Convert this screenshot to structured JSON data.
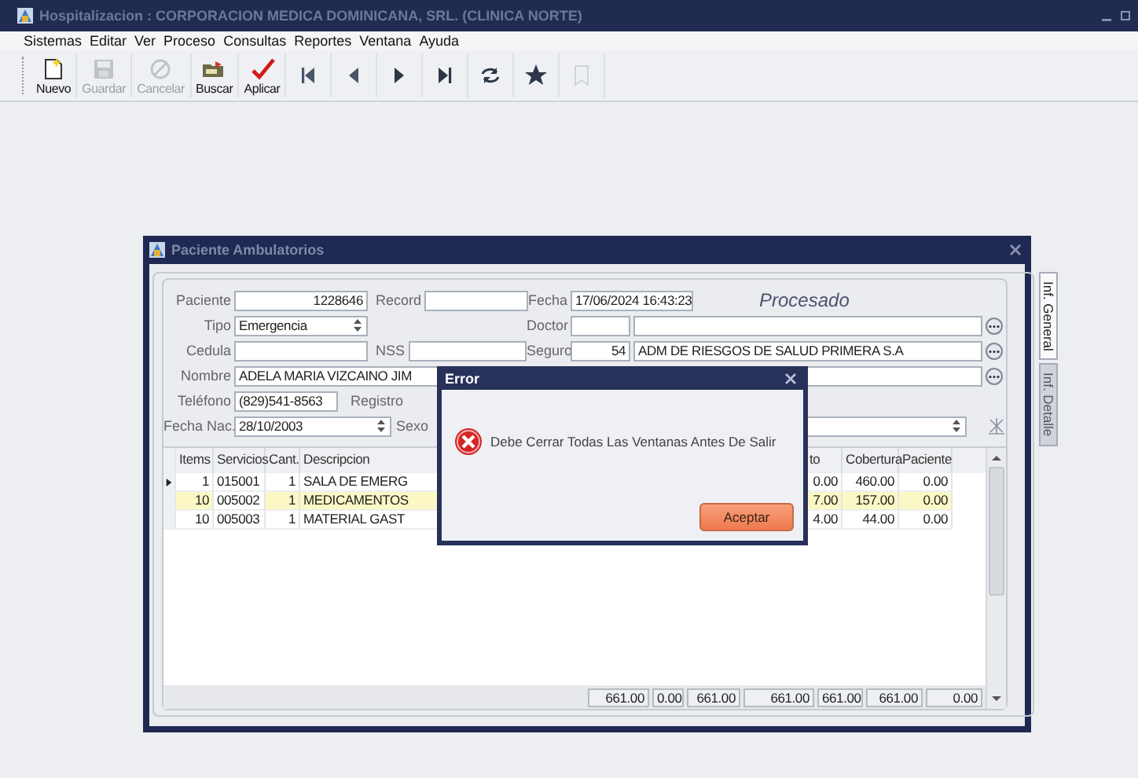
{
  "window": {
    "title": "Hospitalizacion : CORPORACION MEDICA DOMINICANA, SRL. (CLINICA NORTE)"
  },
  "menu": [
    "Sistemas",
    "Editar",
    "Ver",
    "Proceso",
    "Consultas",
    "Reportes",
    "Ventana",
    "Ayuda"
  ],
  "toolbar": [
    {
      "kind": "new",
      "label": "Nuevo",
      "disabled": false
    },
    {
      "kind": "save",
      "label": "Guardar",
      "disabled": true
    },
    {
      "kind": "cancel",
      "label": "Cancelar",
      "disabled": true
    },
    {
      "kind": "search",
      "label": "Buscar",
      "disabled": false
    },
    {
      "kind": "apply",
      "label": "Aplicar",
      "disabled": false
    },
    {
      "kind": "first",
      "disabled": false
    },
    {
      "kind": "prev",
      "disabled": false
    },
    {
      "kind": "next",
      "disabled": false
    },
    {
      "kind": "last",
      "disabled": false
    },
    {
      "kind": "refresh",
      "disabled": false
    },
    {
      "kind": "star",
      "disabled": false
    },
    {
      "kind": "bookmark",
      "disabled": true
    }
  ],
  "child_window": {
    "title": "Paciente Ambulatorios",
    "tabs": [
      {
        "label": "Inf. General",
        "selected": true
      },
      {
        "label": "Inf. Detalle",
        "selected": false
      }
    ],
    "form": {
      "paciente": {
        "label": "Paciente",
        "value": "1228646"
      },
      "record": {
        "label": "Record"
      },
      "fecha": {
        "label": "Fecha",
        "value": "17/06/2024 16:43:23"
      },
      "status": "Procesado",
      "tipo": {
        "label": "Tipo",
        "value": "Emergencia"
      },
      "doctor": {
        "label": "Doctor"
      },
      "cedula": {
        "label": "Cedula"
      },
      "nss": {
        "label": "NSS"
      },
      "seguro": {
        "label": "Seguro",
        "code": "54",
        "value": "ADM DE RIESGOS DE SALUD PRIMERA S.A"
      },
      "nombre": {
        "label": "Nombre",
        "value": "ADELA MARIA VIZCAINO JIM"
      },
      "telefono": {
        "label": "Teléfono",
        "value": "(829)541-8563"
      },
      "registro": {
        "label": "Registro"
      },
      "fecha_nac": {
        "label": "Fecha Nac.",
        "value": "28/10/2003"
      },
      "sexo": {
        "label": "Sexo"
      }
    },
    "grid": {
      "columns": [
        "Items",
        "Servicios",
        "Cant.",
        "Descripcion",
        "to",
        "Cobertura",
        "Paciente"
      ],
      "rows": [
        {
          "current": true,
          "highlighted": false,
          "cells": [
            "1",
            "015001",
            "1",
            "SALA DE EMERG",
            "0.00",
            "460.00",
            "0.00"
          ]
        },
        {
          "current": false,
          "highlighted": true,
          "cells": [
            "10",
            "005002",
            "1",
            "MEDICAMENTOS",
            "7.00",
            "157.00",
            "0.00"
          ]
        },
        {
          "current": false,
          "highlighted": false,
          "cells": [
            "10",
            "005003",
            "1",
            "MATERIAL GAST",
            "4.00",
            "44.00",
            "0.00"
          ]
        }
      ],
      "totals": [
        "661.00",
        "0.00",
        "661.00",
        "661.00",
        "661.00",
        "661.00",
        "0.00"
      ]
    }
  },
  "dialog": {
    "title": "Error",
    "message": "Debe Cerrar Todas Las Ventanas Antes De Salir",
    "button": "Aceptar"
  }
}
